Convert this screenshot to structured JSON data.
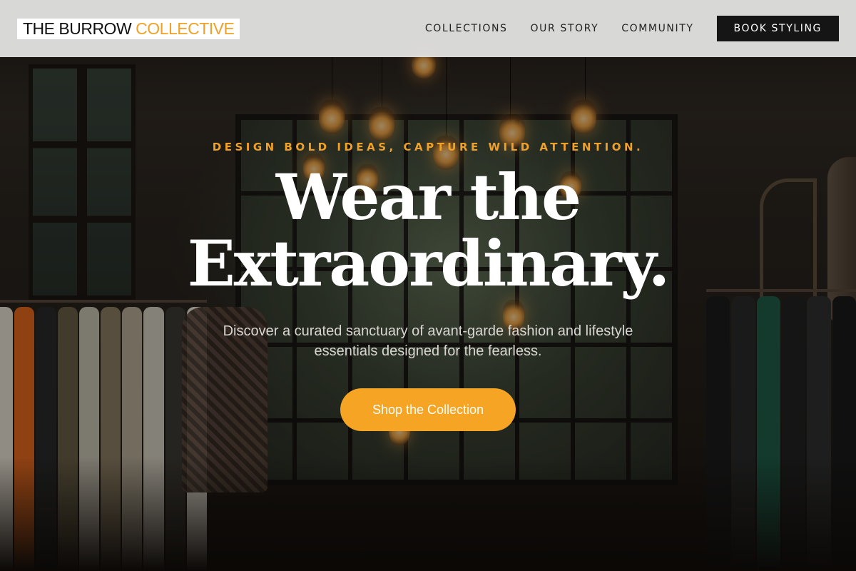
{
  "brand": {
    "name_part1": "THE BURROW",
    "name_part2": "COLLECTIVE",
    "accent_color": "#f0a127"
  },
  "nav": {
    "items": [
      {
        "label": "COLLECTIONS"
      },
      {
        "label": "OUR STORY"
      },
      {
        "label": "COMMUNITY"
      }
    ],
    "cta_label": "BOOK STYLING"
  },
  "hero": {
    "eyebrow": "DESIGN BOLD IDEAS, CAPTURE WILD ATTENTION.",
    "headline_line1": "Wear the",
    "headline_line2": "Extraordinary.",
    "subtext": "Discover a curated sanctuary of avant-garde fashion and lifestyle essentials designed for the fearless.",
    "cta_label": "Shop the Collection",
    "cta_color": "#f5a423"
  }
}
